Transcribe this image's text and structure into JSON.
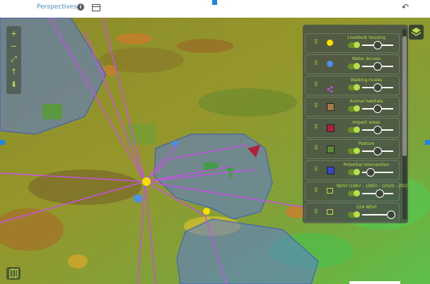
{
  "header": {
    "title": "Perspectives",
    "info_label": "i"
  },
  "map_controls": {
    "zoom_in": "+",
    "zoom_out": "−",
    "fit": "⤢",
    "north": "↑",
    "download": "⬇"
  },
  "layers": [
    {
      "label": "Livestock housing",
      "symbol": "dot",
      "color": "#f5e000",
      "opacity": 0.47
    },
    {
      "label": "Water Access",
      "symbol": "dot",
      "color": "#4a8fe8",
      "opacity": 0.47
    },
    {
      "label": "Walking routes",
      "symbol": "share",
      "color": "#c850e8",
      "opacity": 0.47
    },
    {
      "label": "Animal habitats",
      "symbol": "square",
      "color": "#a37a4a",
      "opacity": 0.47
    },
    {
      "label": "Impact areas",
      "symbol": "square",
      "color": "#b0203a",
      "opacity": 0.47
    },
    {
      "label": "Pasture",
      "symbol": "square",
      "color": "#5a8a3a",
      "opacity": 0.47
    },
    {
      "label": "Potential intervention",
      "symbol": "square",
      "color": "#3a44c8",
      "opacity": 0.25
    },
    {
      "label": "NDVI (1987 - 1995) - (2020 - 2023)",
      "symbol": "raster",
      "color": "#b8e04a",
      "opacity": 0.55
    },
    {
      "label": "S2A NDVI",
      "symbol": "raster",
      "color": "#b8e04a",
      "opacity": 0.9
    }
  ]
}
